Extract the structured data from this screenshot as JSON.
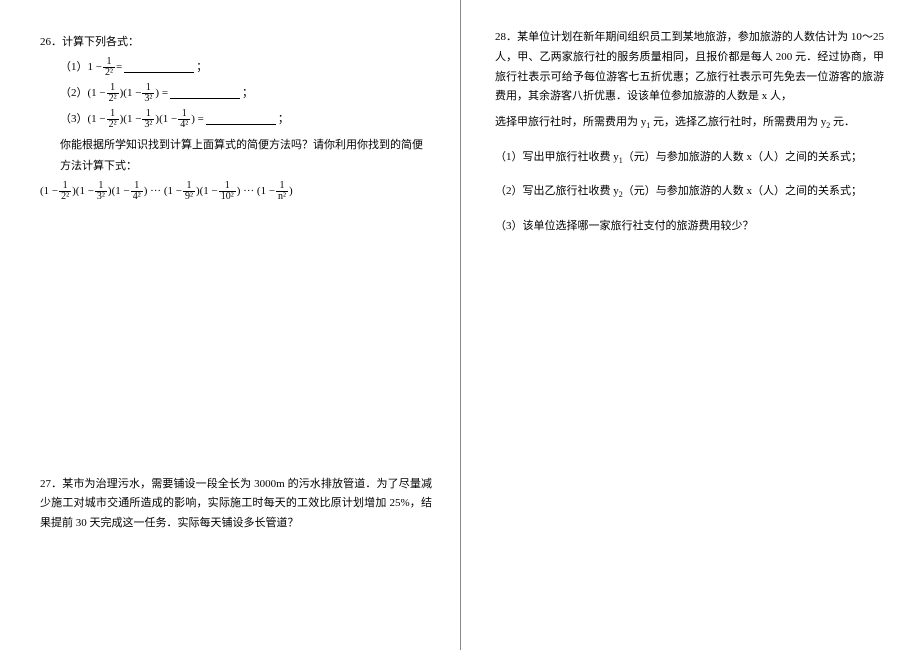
{
  "left": {
    "q26": {
      "num": "26．",
      "title": "计算下列各式：",
      "item1_prefix": "（1）",
      "item1_lparen": "1 −",
      "item1_rparen": " = ",
      "item1_suffix": "；",
      "item2_prefix": "（2）",
      "item2_text_a": "(1 − ",
      "item2_text_b": ")(1 − ",
      "item2_text_c": ") = ",
      "item2_suffix": "；",
      "item3_prefix": "（3）",
      "item3_a": "(1 − ",
      "item3_b": ")(1 − ",
      "item3_c": ")(1 − ",
      "item3_d": ") = ",
      "item3_suffix": "；",
      "explain": "你能根据所学知识找到计算上面算式的简便方法吗？请你利用你找到的简便方法计算下式：",
      "final_a": "(1 − ",
      "final_b": ")(1 − ",
      "final_c": ") ··· (1 − ",
      "final_d": ")(1 − ",
      "final_e": ") ··· (1 − ",
      "final_f": ")",
      "f_2_2": "2",
      "f_2_2d": "2²",
      "f_3_2d": "3²",
      "f_4_2d": "4²",
      "f_9_2d": "9²",
      "f_10_2d": "10²",
      "f_n_2d": "n²",
      "one": "1"
    },
    "q27": {
      "num": "27．",
      "text": "某市为治理污水，需要铺设一段全长为 3000m 的污水排放管道．为了尽量减少施工对城市交通所造成的影响，实际施工时每天的工效比原计划增加 25%，结果提前 30 天完成这一任务．实际每天铺设多长管道？"
    }
  },
  "right": {
    "q28": {
      "num": "28．",
      "intro": "某单位计划在新年期间组织员工到某地旅游，参加旅游的人数估计为 10～25 人，甲、乙两家旅行社的服务质量相同，且报价都是每人 200 元．经过协商，甲旅行社表示可给予每位游客七五折优惠；乙旅行社表示可先免去一位游客的旅游费用，其余游客八折优惠．设该单位参加旅游的人数是 x 人，",
      "intro2a": "选择甲旅行社时，所需费用为 y",
      "intro2_sub1": "1",
      "intro2b": " 元，选择乙旅行社时，所需费用为 y",
      "intro2_sub2": "2",
      "intro2c": " 元．",
      "p1a": "（1）写出甲旅行社收费 y",
      "p1_sub": "1",
      "p1b": "（元）与参加旅游的人数 x（人）之间的关系式；",
      "p2a": "（2）写出乙旅行社收费 y",
      "p2_sub": "2",
      "p2b": "（元）与参加旅游的人数 x（人）之间的关系式；",
      "p3": "（3）该单位选择哪一家旅行社支付的旅游费用较少？"
    }
  }
}
